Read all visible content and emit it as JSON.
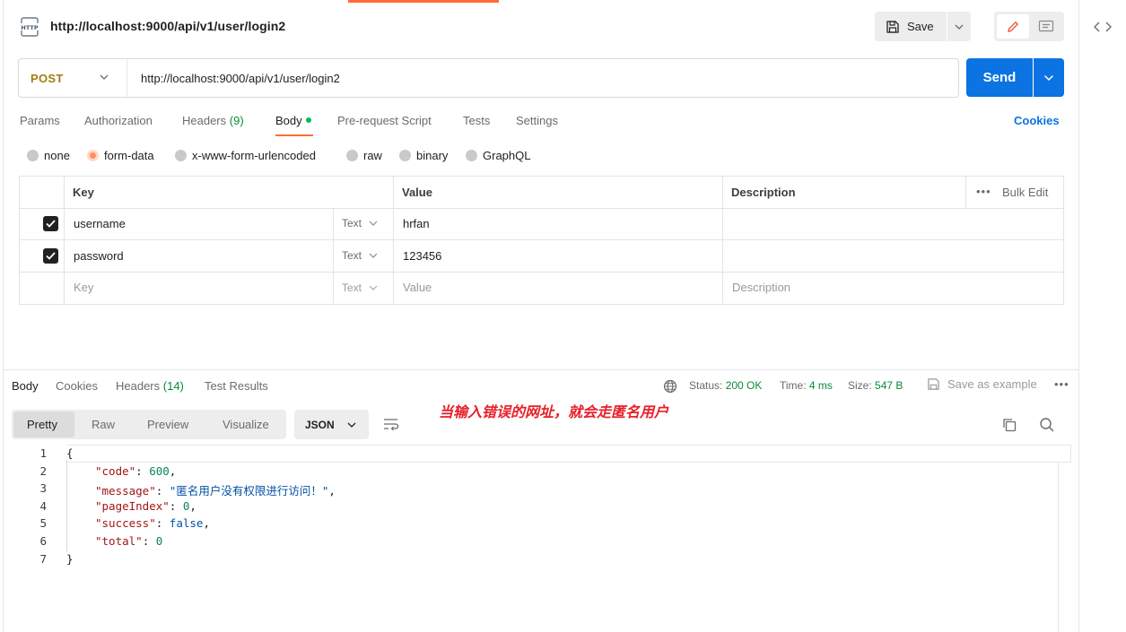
{
  "request": {
    "title": "http://localhost:9000/api/v1/user/login2",
    "method": "POST",
    "url": "http://localhost:9000/api/v1/user/login2",
    "save_label": "Save",
    "send_label": "Send",
    "http_icon_text": "HTTP"
  },
  "tabs": {
    "params": "Params",
    "authorization": "Authorization",
    "headers": "Headers",
    "headers_count": "(9)",
    "body": "Body",
    "prerequest": "Pre-request Script",
    "tests": "Tests",
    "settings": "Settings",
    "cookies": "Cookies"
  },
  "body_types": {
    "none": "none",
    "form_data": "form-data",
    "urlencoded": "x-www-form-urlencoded",
    "raw": "raw",
    "binary": "binary",
    "graphql": "GraphQL",
    "selected": "form-data"
  },
  "table": {
    "headers": {
      "key": "Key",
      "value": "Value",
      "description": "Description",
      "bulk_edit": "Bulk Edit"
    },
    "rows": [
      {
        "key": "username",
        "type": "Text",
        "value": "hrfan",
        "description": "",
        "checked": true
      },
      {
        "key": "password",
        "type": "Text",
        "value": "123456",
        "description": "",
        "checked": true
      }
    ],
    "new_row": {
      "key": "Key",
      "type": "Text",
      "value": "Value",
      "description": "Description"
    }
  },
  "response": {
    "tabs": {
      "body": "Body",
      "cookies": "Cookies",
      "headers": "Headers",
      "headers_count": "(14)",
      "test_results": "Test Results"
    },
    "status_label": "Status:",
    "status_value": "200 OK",
    "time_label": "Time:",
    "time_value": "4 ms",
    "size_label": "Size:",
    "size_value": "547 B",
    "save_example": "Save as example",
    "views": {
      "pretty": "Pretty",
      "raw": "Raw",
      "preview": "Preview",
      "visualize": "Visualize"
    },
    "format": "JSON",
    "annotation": "当输入错误的网址，就会走匿名用户",
    "code": {
      "line_numbers": [
        "1",
        "2",
        "3",
        "4",
        "5",
        "6",
        "7"
      ],
      "open_brace": "{",
      "close_brace": "}",
      "code_key": "\"code\"",
      "code_val": "600",
      "message_key": "\"message\"",
      "message_val": "\"匿名用户没有权限进行访问！\"",
      "pageIndex_key": "\"pageIndex\"",
      "pageIndex_val": "0",
      "success_key": "\"success\"",
      "success_val": "false",
      "total_key": "\"total\"",
      "total_val": "0"
    }
  },
  "colors": {
    "accent": "#ff6c37",
    "primary": "#0b73e2",
    "method_post": "#a57c14",
    "status_ok": "#0a8a3a",
    "annotation": "#e8202a"
  }
}
